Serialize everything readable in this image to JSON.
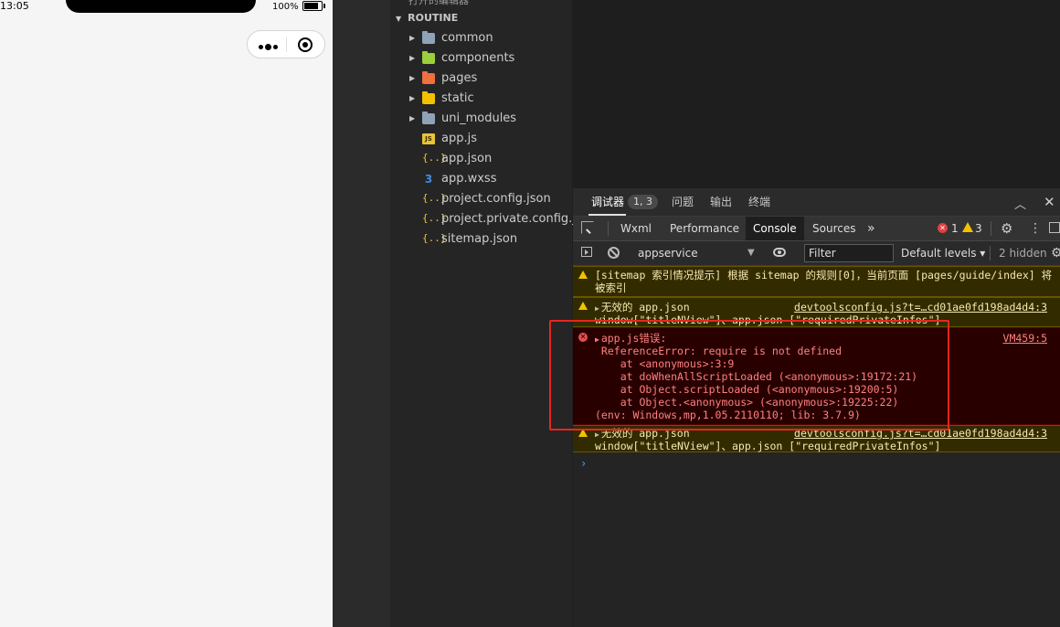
{
  "simulator": {
    "status_time": "13:05",
    "battery_pct": "100%"
  },
  "explorer": {
    "top_clipped_label": "打开的编辑器",
    "section_title": "ROUTINE",
    "items": [
      {
        "label": "common",
        "type": "folder",
        "color": "#8fa3b8"
      },
      {
        "label": "components",
        "type": "folder",
        "color": "#9bcf3c"
      },
      {
        "label": "pages",
        "type": "folder",
        "color": "#f07040"
      },
      {
        "label": "static",
        "type": "folder",
        "color": "#f2c200"
      },
      {
        "label": "uni_modules",
        "type": "folder",
        "color": "#8fa3b8"
      },
      {
        "label": "app.js",
        "type": "js"
      },
      {
        "label": "app.json",
        "type": "json"
      },
      {
        "label": "app.wxss",
        "type": "css"
      },
      {
        "label": "project.config.json",
        "type": "json"
      },
      {
        "label": "project.private.config.js...",
        "type": "json"
      },
      {
        "label": "sitemap.json",
        "type": "json"
      }
    ]
  },
  "devtools": {
    "tabs": {
      "debugger": "调试器",
      "badge": "1, 3",
      "issues": "问题",
      "output": "输出",
      "terminal": "终端"
    },
    "panel_tabs": {
      "wxml": "Wxml",
      "performance": "Performance",
      "console": "Console",
      "sources": "Sources",
      "more": "»"
    },
    "counts": {
      "errors": "1",
      "warnings": "3"
    },
    "toolbar": {
      "context": "appservice",
      "filter_placeholder": "Filter",
      "levels": "Default levels ▾",
      "hidden": "2 hidden"
    },
    "messages": [
      {
        "level": "warning",
        "lines": [
          "[sitemap 索引情况提示] 根据 sitemap 的规则[0]，当前页面 [pages/guide/index] 将",
          "被索引"
        ]
      },
      {
        "level": "warning",
        "lines": [
          "无效的 app.json",
          "window[\"titleNView\"]、app.json [\"requiredPrivateInfos\"]"
        ],
        "source": "devtoolsconfig.js?t=…cd01ae0fd198ad4d4:3"
      },
      {
        "level": "error",
        "lines": [
          "app.js错误:",
          " ReferenceError: require is not defined",
          "    at <anonymous>:3:9",
          "    at doWhenAllScriptLoaded (<anonymous>:19172:21)",
          "    at Object.scriptLoaded (<anonymous>:19200:5)",
          "    at Object.<anonymous> (<anonymous>:19225:22)",
          "(env: Windows,mp,1.05.2110110; lib: 3.7.9)"
        ],
        "source": "VM459:5"
      },
      {
        "level": "warning",
        "lines": [
          "无效的 app.json",
          "window[\"titleNView\"]、app.json [\"requiredPrivateInfos\"]"
        ],
        "source": "devtoolsconfig.js?t=…cd01ae0fd198ad4d4:3"
      }
    ],
    "prompt": "›"
  }
}
